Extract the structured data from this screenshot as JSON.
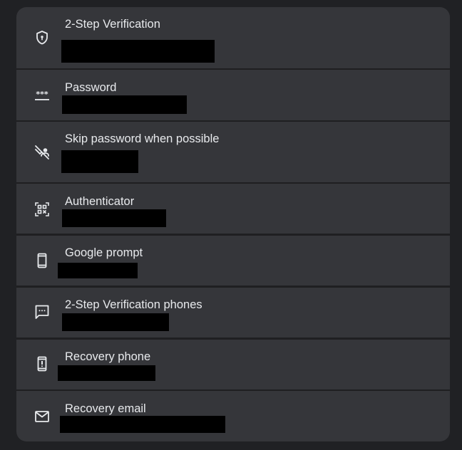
{
  "security": {
    "items": [
      {
        "label": "2-Step Verification",
        "icon": "shield-lock-icon",
        "value_redacted": true
      },
      {
        "label": "Password",
        "icon": "password-dots-icon",
        "value_redacted": true
      },
      {
        "label": "Skip password when possible",
        "icon": "passkey-icon",
        "value_redacted": true
      },
      {
        "label": "Authenticator",
        "icon": "qr-scan-icon",
        "value_redacted": true
      },
      {
        "label": "Google prompt",
        "icon": "smartphone-icon",
        "value_redacted": true
      },
      {
        "label": "2-Step Verification phones",
        "icon": "sms-message-icon",
        "value_redacted": true
      },
      {
        "label": "Recovery phone",
        "icon": "phone-alert-icon",
        "value_redacted": true
      },
      {
        "label": "Recovery email",
        "icon": "mail-icon",
        "value_redacted": true
      }
    ]
  },
  "colors": {
    "page_background": "#202124",
    "row_background": "#35363a",
    "text": "#e8eaed",
    "icon": "#e8eaed",
    "redaction": "#000000"
  }
}
